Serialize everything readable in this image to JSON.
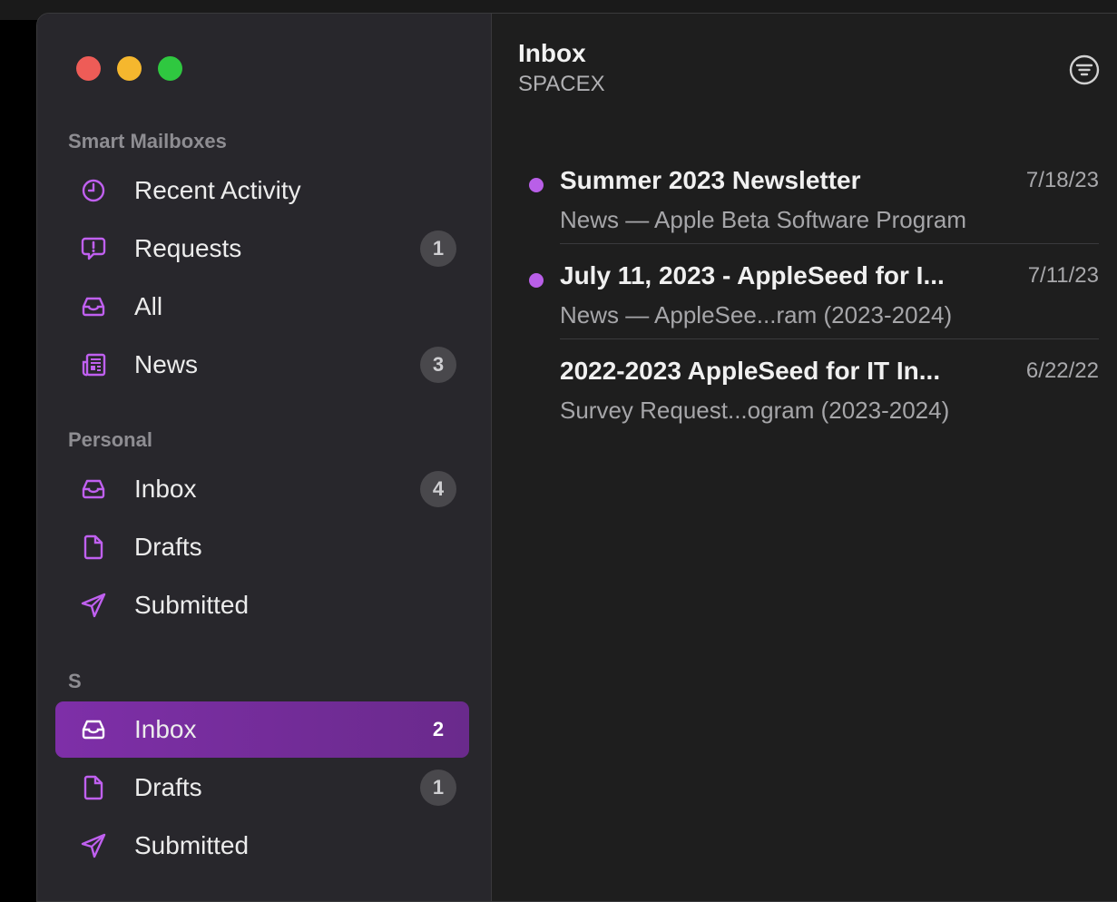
{
  "sidebar": {
    "sections": {
      "smart": "Smart Mailboxes",
      "personal": "Personal",
      "s": "S"
    },
    "smart_items": [
      {
        "label": "Recent Activity",
        "icon": "clock-icon",
        "badge": ""
      },
      {
        "label": "Requests",
        "icon": "exclamation-bubble-icon",
        "badge": "1"
      },
      {
        "label": "All",
        "icon": "tray-icon",
        "badge": ""
      },
      {
        "label": "News",
        "icon": "newspaper-icon",
        "badge": "3"
      }
    ],
    "personal_items": [
      {
        "label": "Inbox",
        "icon": "tray-icon",
        "badge": "4"
      },
      {
        "label": "Drafts",
        "icon": "document-icon",
        "badge": ""
      },
      {
        "label": "Submitted",
        "icon": "paperplane-icon",
        "badge": ""
      }
    ],
    "s_items": [
      {
        "label": "Inbox",
        "icon": "tray-icon",
        "badge": "2",
        "selected": true
      },
      {
        "label": "Drafts",
        "icon": "document-icon",
        "badge": "1"
      },
      {
        "label": "Submitted",
        "icon": "paperplane-icon",
        "badge": ""
      }
    ],
    "accent": "#c060f0",
    "selected_bg": "#7a2ea3"
  },
  "header": {
    "title": "Inbox",
    "subtitle": "SPACEX",
    "filter_icon": "filter-icon"
  },
  "messages": [
    {
      "subject": "Summer 2023 Newsletter",
      "date": "7/18/23",
      "preview": "News — Apple Beta Software Program",
      "unread": true
    },
    {
      "subject": "July 11, 2023 - AppleSeed for I...",
      "date": "7/11/23",
      "preview": "News — AppleSee...ram (2023-2024)",
      "unread": true
    },
    {
      "subject": "2022-2023 AppleSeed for IT In...",
      "date": "6/22/22",
      "preview": "Survey Request...ogram (2023-2024)",
      "unread": false
    }
  ]
}
